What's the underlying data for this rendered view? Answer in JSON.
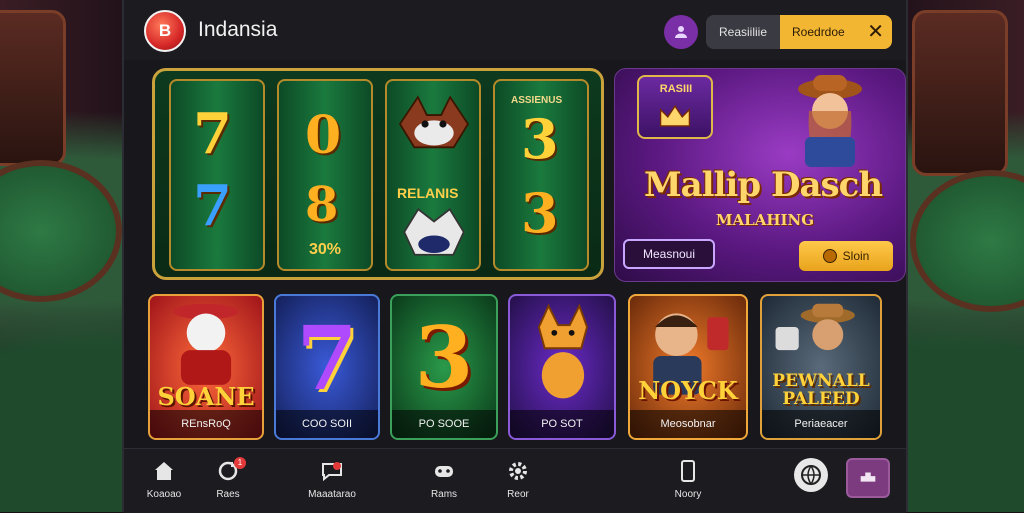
{
  "header": {
    "logo_text": "B",
    "brand": "Indansia",
    "pill_left": "Reasiiliie",
    "pill_right": "Roedrdoe",
    "close_icon": "close-icon",
    "profile_icon": "user-icon"
  },
  "reels": {
    "top_label": "ASSIENUS",
    "side_label": "RELANIS",
    "percent_label": "30%",
    "symbols": [
      "7",
      "0",
      "3",
      "7",
      "8",
      "3"
    ]
  },
  "promo": {
    "badge_text": "RASIII",
    "title": "Mallip Dasch",
    "subtitle": "MALAHING",
    "outline_button": "Measnoui",
    "gold_button": "Sloin",
    "gold_button_icon": "coin-icon"
  },
  "games": [
    {
      "art_text": "SOANE",
      "name": "REnsRoQ",
      "bg": "#c0262a"
    },
    {
      "art_text": "7",
      "name": "COO SOII",
      "bg": "#1e3a8a"
    },
    {
      "art_text": "3",
      "name": "PO SOOE",
      "bg": "#14532d"
    },
    {
      "art_text": "",
      "name": "PO SOT",
      "bg": "#3b1c72"
    },
    {
      "art_text": "NOYCK",
      "name": "Meosobnar",
      "bg": "#b8561a"
    },
    {
      "art_text": "PEWNALL PALEED",
      "name": "Periaeacer",
      "bg": "#3a4a5a"
    }
  ],
  "nav": [
    {
      "label": "Koaoao",
      "icon": "home-icon"
    },
    {
      "label": "Raes",
      "icon": "refresh-icon",
      "badge": "1"
    },
    {
      "label": "Maaatarao",
      "icon": "chat-icon"
    },
    {
      "label": "Rams",
      "icon": "gamepad-icon"
    },
    {
      "label": "Reor",
      "icon": "gear-icon"
    },
    {
      "label": "Noory",
      "icon": "phone-icon"
    }
  ],
  "nav_extra": {
    "circle_icon": "globe-icon",
    "active_icon": "puzzle-icon"
  }
}
